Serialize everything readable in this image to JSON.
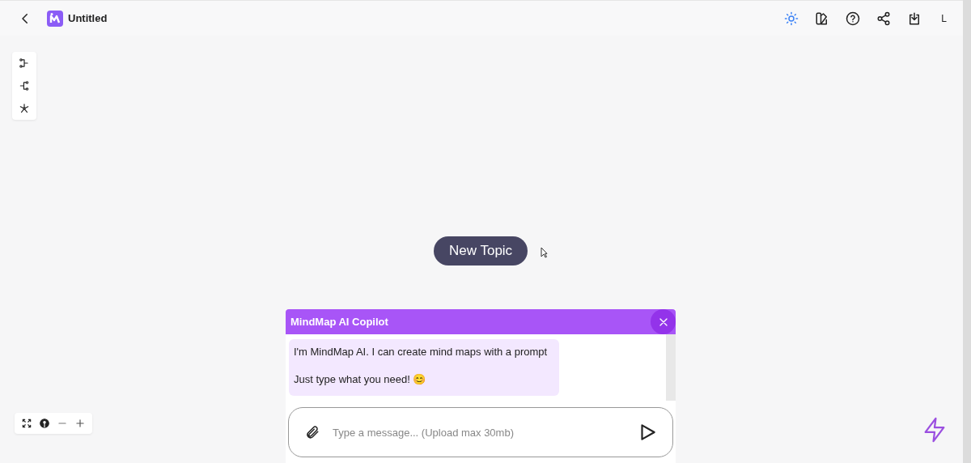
{
  "header": {
    "title": "Untitled",
    "avatar": "L"
  },
  "canvas": {
    "node": "New Topic"
  },
  "copilot": {
    "title": "MindMap AI Copilot",
    "messages": [
      {
        "lines": [
          "I'm MindMap AI. I can create mind maps with a prompt",
          "Just type what you need! 😊"
        ]
      }
    ],
    "input": {
      "placeholder": "Type a message... (Upload max 30mb)"
    }
  }
}
